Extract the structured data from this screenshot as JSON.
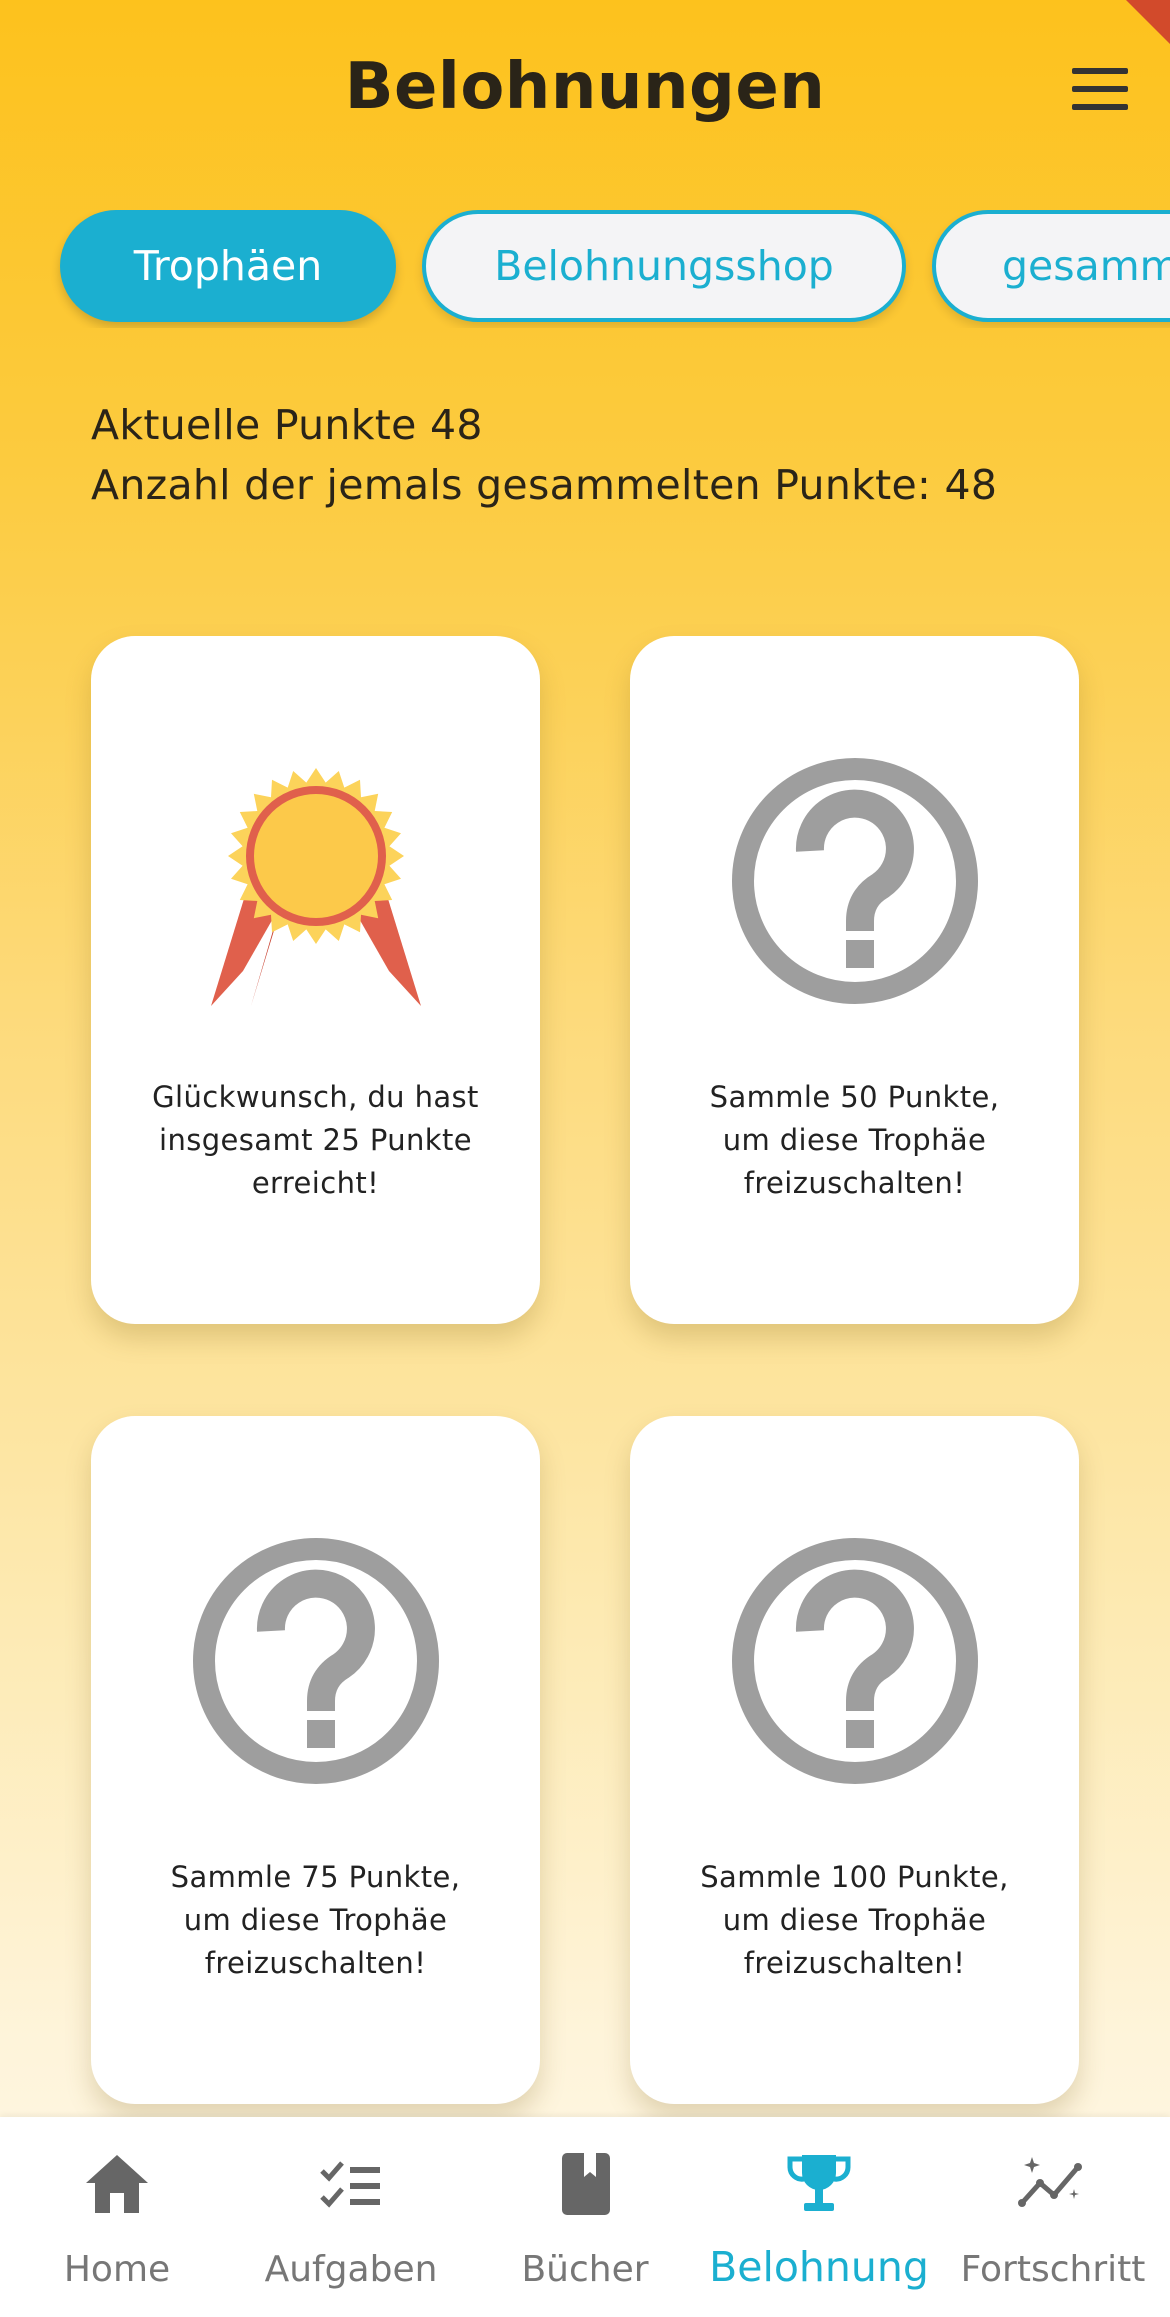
{
  "header": {
    "title": "Belohnungen",
    "menu_icon": "hamburger-menu-icon"
  },
  "tabs": [
    {
      "label": "Trophäen",
      "active": true
    },
    {
      "label": "Belohnungsshop",
      "active": false
    },
    {
      "label": "gesammelte Belohnungen",
      "active": false
    }
  ],
  "points": {
    "current": "Aktuelle Punkte 48",
    "total": "Anzahl der jemals gesammelten Punkte: 48"
  },
  "trophies": [
    {
      "text": "Glückwunsch, du hast\ninsgesamt 25 Punkte\nerreicht!",
      "unlocked": true,
      "icon": "award-ribbon-icon"
    },
    {
      "text": "Sammle 50 Punkte,\num diese Trophäe\nfreizuschalten!",
      "unlocked": false,
      "icon": "question-circle-icon"
    },
    {
      "text": "Sammle 75 Punkte,\num diese Trophäe\nfreizuschalten!",
      "unlocked": false,
      "icon": "question-circle-icon"
    },
    {
      "text": "Sammle 100 Punkte,\num diese Trophäe\nfreizuschalten!",
      "unlocked": false,
      "icon": "question-circle-icon"
    }
  ],
  "bottom_nav": [
    {
      "label": "Home",
      "icon": "home-icon",
      "active": false
    },
    {
      "label": "Aufgaben",
      "icon": "checklist-icon",
      "active": false
    },
    {
      "label": "Bücher",
      "icon": "book-icon",
      "active": false
    },
    {
      "label": "Belohnung",
      "icon": "trophy-icon",
      "active": true
    },
    {
      "label": "Fortschritt",
      "icon": "progress-chart-icon",
      "active": false
    }
  ],
  "colors": {
    "accent": "#1BAFD0",
    "background_top": "#FDC21D",
    "background_bottom": "#FFF8E8",
    "locked_icon": "#9E9E9E",
    "medal_gold": "#FCD35A",
    "medal_red": "#E0604C"
  }
}
